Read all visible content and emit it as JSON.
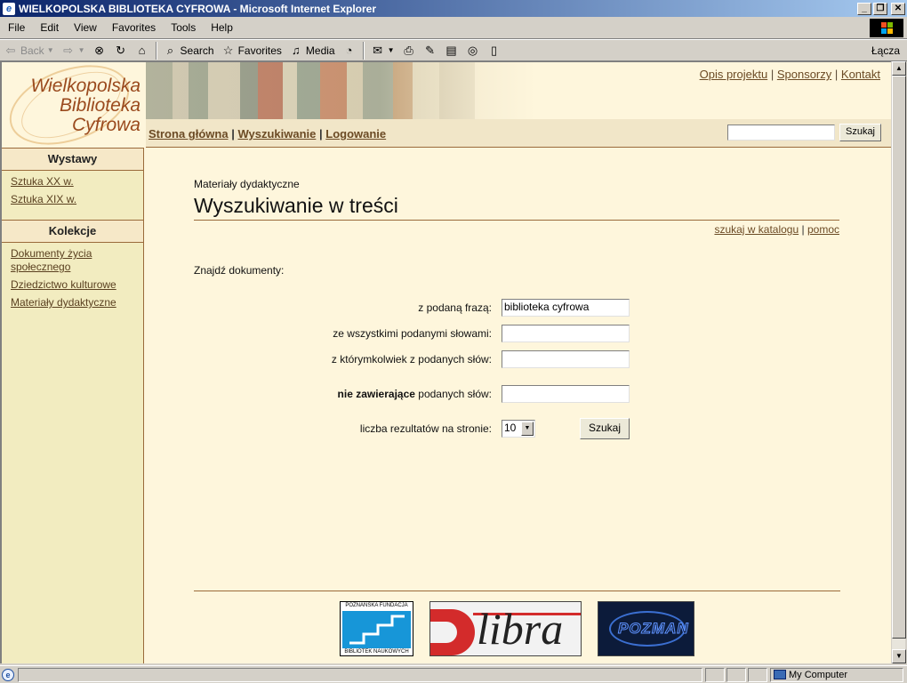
{
  "window": {
    "title": "WIELKOPOLSKA BIBLIOTEKA CYFROWA - Microsoft Internet Explorer",
    "minimize": "_",
    "maximize": "❐",
    "close": "✕"
  },
  "menu": [
    "File",
    "Edit",
    "View",
    "Favorites",
    "Tools",
    "Help"
  ],
  "toolbar": {
    "back": "Back",
    "search": "Search",
    "favorites": "Favorites",
    "media": "Media",
    "links": "Łącza"
  },
  "logo": {
    "line1": "Wielkopolska",
    "line2": "Biblioteka",
    "line3": "Cyfrowa"
  },
  "toplinks": [
    "Opis projektu",
    "Sponsorzy",
    "Kontakt"
  ],
  "nav": [
    "Strona główna",
    "Wyszukiwanie",
    "Logowanie"
  ],
  "header_search": {
    "button": "Szukaj"
  },
  "sidebar": {
    "wystawy": {
      "title": "Wystawy",
      "items": [
        "Sztuka XX w.",
        "Sztuka XIX w."
      ]
    },
    "kolekcje": {
      "title": "Kolekcje",
      "items": [
        "Dokumenty życia społecznego",
        "Dziedzictwo kulturowe",
        "Materiały dydaktyczne"
      ]
    }
  },
  "main": {
    "breadcrumb": "Materiały dydaktyczne",
    "title": "Wyszukiwanie w treści",
    "sublinks": [
      "szukaj w katalogu",
      "pomoc"
    ],
    "find_label": "Znajdź dokumenty:"
  },
  "form": {
    "phrase_label": "z podaną frazą:",
    "phrase_value": "biblioteka cyfrowa",
    "all_words_label": "ze wszystkimi podanymi słowami:",
    "any_words_label": "z którymkolwiek z podanych słów:",
    "none_words_bold": "nie zawierające",
    "none_words_rest": " podanych słów:",
    "results_label": "liczba rezultatów na stronie:",
    "results_value": "10",
    "submit": "Szukaj"
  },
  "sponsors": {
    "fundacja_top": "POZNAŃSKA FUNDACJA",
    "fundacja_bottom": "BIBLIOTEK NAUKOWYCH",
    "dlibra": "libra",
    "pozman": "POZMAN"
  },
  "statusbar": {
    "zone": "My Computer"
  },
  "colors": {
    "page_bg": "#fef6dc",
    "sidebar_bg": "#f2ecc0",
    "link": "#6b4a24",
    "rule": "#9a6a3a"
  }
}
